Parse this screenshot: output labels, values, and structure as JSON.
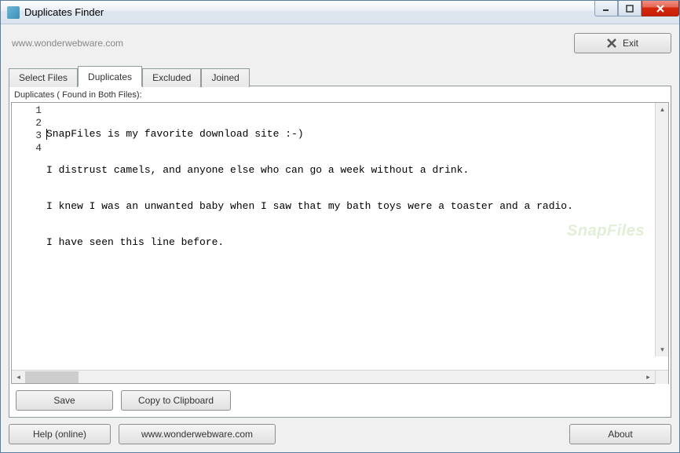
{
  "window": {
    "title": "Duplicates Finder"
  },
  "header": {
    "url": "www.wonderwebware.com",
    "exit_label": "Exit"
  },
  "tabs": [
    {
      "label": "Select Files"
    },
    {
      "label": "Duplicates"
    },
    {
      "label": "Excluded"
    },
    {
      "label": "Joined"
    }
  ],
  "active_tab": 1,
  "panel": {
    "caption": "Duplicates ( Found in Both Files):",
    "lines": [
      "SnapFiles is my favorite download site :-)",
      "I distrust camels, and anyone else who can go a week without a drink.",
      "I knew I was an unwanted baby when I saw that my bath toys were a toaster and a radio.",
      "I have seen this line before."
    ],
    "save_label": "Save",
    "copy_label": "Copy to Clipboard"
  },
  "footer": {
    "help_label": "Help (online)",
    "site_label": "www.wonderwebware.com",
    "about_label": "About"
  },
  "watermark": "SnapFiles"
}
